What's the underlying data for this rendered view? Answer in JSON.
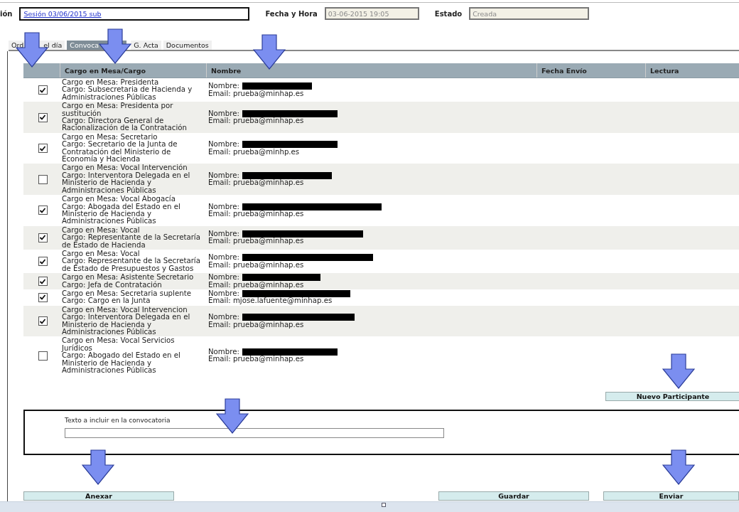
{
  "header": {
    "session_label": "ión",
    "session_link": "Sesión 03/06/2015 sub",
    "date_label": "Fecha y Hora",
    "date_value": "03-06-2015 19:05",
    "state_label": "Estado",
    "state_value": "Creada"
  },
  "tabs": [
    {
      "label": "Ord",
      "label_after": "el día",
      "selected": false
    },
    {
      "label": "Convoca",
      "selected": true
    },
    {
      "label": "G. Acta",
      "selected": false
    },
    {
      "label": "Documentos",
      "selected": false
    }
  ],
  "table": {
    "columns": [
      "",
      "Cargo en Mesa/Cargo",
      "Nombre",
      "Fecha Envío",
      "Lectura"
    ],
    "rows": [
      {
        "checked": true,
        "mesa": "Cargo en Mesa: Presidenta",
        "cargo": "Cargo: Subsecretaria de Hacienda y Administraciones Públicas",
        "nombre": "Nombre:",
        "email": "Email: prueba@minhap.es"
      },
      {
        "checked": true,
        "mesa": "Cargo en Mesa: Presidenta por sustitución",
        "cargo": "Cargo: Directora General de Racionalización de la Contratación",
        "nombre": "Nombre:",
        "email": "Email: prueba@minhap.es"
      },
      {
        "checked": true,
        "mesa": "Cargo en Mesa: Secretario",
        "cargo": "Cargo: Secretario de la Junta de Contratación del Ministerio de Economía y Hacienda",
        "nombre": "Nombre:",
        "email": "Email: prueba@minhp.es"
      },
      {
        "checked": false,
        "mesa": "Cargo en Mesa: Vocal Intervención",
        "cargo": "Cargo: Interventora Delegada en el Ministerio de Hacienda y Administraciones Públicas",
        "nombre": "Nombre:",
        "email": "Email: prueba@minhap.es"
      },
      {
        "checked": true,
        "mesa": "Cargo en Mesa: Vocal Abogacía",
        "cargo": "Cargo: Abogada del Estado en el Ministerio de Hacienda y Administraciones Públicas",
        "nombre": "Nombre:",
        "email": "Email: prueba@minhap.es"
      },
      {
        "checked": true,
        "mesa": "Cargo en Mesa: Vocal",
        "cargo": "Cargo: Representante de la Secretaría de Estado de Hacienda",
        "nombre": "Nombre:",
        "email": "Email: prueba@minhap.es"
      },
      {
        "checked": true,
        "mesa": "Cargo en Mesa: Vocal",
        "cargo": "Cargo: Representante de la Secretaría de Estado de Presupuestos y Gastos",
        "nombre": "Nombre:",
        "email": "Email: prueba@minhap.es"
      },
      {
        "checked": true,
        "mesa": "Cargo en Mesa: Asistente Secretario",
        "cargo": "Cargo: Jefa de Contratación",
        "nombre": "Nombre:",
        "email": "Email: prueba@minhap.es"
      },
      {
        "checked": true,
        "mesa": "Cargo en Mesa: Secretaria suplente",
        "cargo": "Cargo: Cargo en la Junta",
        "nombre": "Nombre:",
        "email": "Email: mjose.lafuente@minhap.es"
      },
      {
        "checked": true,
        "mesa": "Cargo en Mesa: Vocal Intervencion",
        "cargo": "Cargo: Interventora Delegada en el Ministerio de Hacienda y Administraciones Públicas",
        "nombre": "Nombre:",
        "email": "Email: prueba@minhap.es"
      },
      {
        "checked": false,
        "mesa": "Cargo en Mesa: Vocal Servicios Jurídicos",
        "cargo": "Cargo: Abogado del Estado en el Ministerio de Hacienda y Administraciones Públicas",
        "nombre": "Nombre:",
        "email": "Email: prueba@minhap.es"
      }
    ]
  },
  "new_participant_button": "Nuevo Participante",
  "text_box": {
    "label": "Texto a incluir en la convocatoria"
  },
  "buttons": [
    "Anexar",
    "Guardar",
    "Enviar"
  ]
}
